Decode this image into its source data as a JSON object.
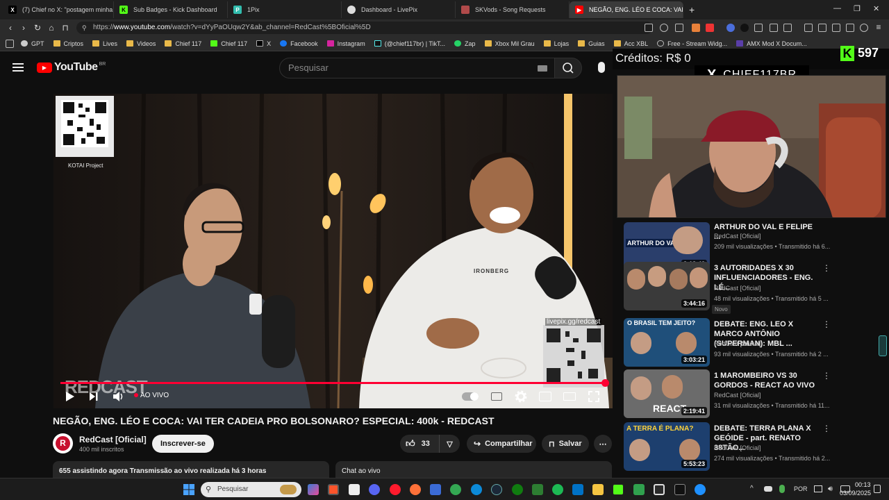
{
  "browser": {
    "tabs": [
      {
        "title": "(7) Chief no X: \"postagem minha de",
        "icon": "x-logo-icon",
        "color": "#000000"
      },
      {
        "title": "Sub Badges - Kick Dashboard",
        "icon": "kick-icon",
        "color": "#53fc18"
      },
      {
        "title": "1Pix",
        "icon": "pix-icon",
        "color": "#32bcad"
      },
      {
        "title": "Dashboard - LivePix",
        "icon": "livepix-icon",
        "color": "#dddddd"
      },
      {
        "title": "SKVods - Song Requests",
        "icon": "skvods-icon",
        "color": "#b04a4a"
      },
      {
        "title": "NEGÃO, ENG. LÉO E COCA: VAI TE",
        "icon": "youtube-icon",
        "color": "#ff0000"
      }
    ],
    "url_prefix": "https://",
    "url_host": "www.youtube.com",
    "url_path": "/watch?v=dYyPaOUqw2Y&ab_channel=RedCast%5BOficial%5D",
    "bookmarks": [
      {
        "label": "GPT",
        "icon": "gpt-icon"
      },
      {
        "label": "Criptos",
        "icon": "folder-icon"
      },
      {
        "label": "Lives",
        "icon": "folder-icon"
      },
      {
        "label": "Videos",
        "icon": "folder-icon"
      },
      {
        "label": "Chief 117",
        "icon": "folder-icon"
      },
      {
        "label": "Chief 117",
        "icon": "kick-icon"
      },
      {
        "label": "X",
        "icon": "x-logo-icon"
      },
      {
        "label": "Facebook",
        "icon": "facebook-icon"
      },
      {
        "label": "Instagram",
        "icon": "instagram-icon"
      },
      {
        "label": "(@chief117br) | TikT...",
        "icon": "tiktok-icon"
      },
      {
        "label": "Zap",
        "icon": "whatsapp-icon"
      },
      {
        "label": "Xbox Mil Grau",
        "icon": "folder-icon"
      },
      {
        "label": "Lojas",
        "icon": "folder-icon"
      },
      {
        "label": "Guias",
        "icon": "folder-icon"
      },
      {
        "label": "Acc XBL",
        "icon": "folder-icon"
      },
      {
        "label": "Free - Stream Widg...",
        "icon": "globe-icon"
      },
      {
        "label": "AMX Mod X Docum...",
        "icon": "amx-icon"
      }
    ]
  },
  "youtube": {
    "logo_text": "YouTube",
    "logo_region": "BR",
    "search_placeholder": "Pesquisar",
    "player": {
      "qr_top_label": "KOTAI Project",
      "qr_bottom_label": "livepix.gg/redcast",
      "watermark": "REDCAST",
      "live_label": "AO VIVO",
      "shirt_text": "IRONBERG",
      "progress_fraction": 1.0
    },
    "video_title": "NEGÃO, ENG. LÉO E COCA: VAI TER CADEIA PRO BOLSONARO? ESPECIAL: 400k - REDCAST",
    "channel_name": "RedCast [Oficial]",
    "subscribers": "400 mil inscritos",
    "subscribe_label": "Inscrever-se",
    "likes": "33",
    "share_label": "Compartilhar",
    "save_label": "Salvar",
    "stats_text": "655 assistindo agora  Transmissão ao vivo realizada há 3 horas",
    "chat_label": "Chat ao vivo"
  },
  "overlay": {
    "credits": "Créditos: R$ 0",
    "kick_count": "597",
    "handle": "CHIEF117BR"
  },
  "recommendations": [
    {
      "title": "ARTHUR DO VAL E FELIPE ...",
      "channel": "RedCast [Oficial]",
      "meta": "209 mil visualizações • Transmitido há 6...",
      "duration": "3:18:42",
      "badge": "",
      "thumb_color": "#2a3e6b",
      "thumb_text": "ARTHUR DO VAL"
    },
    {
      "title": "3 AUTORIDADES X 30 INFLUENCIADORES - ENG. LÉ...",
      "channel": "RedCast [Oficial]",
      "meta": "48 mil visualizações • Transmitido há 5 ...",
      "duration": "3:44:16",
      "badge": "Novo",
      "thumb_color": "#3a3a3a",
      "thumb_text": ""
    },
    {
      "title": "DEBATE: ENG. LEO X MARCO ANTÔNIO (SUPERMAN): MBL ...",
      "channel": "RedCast [Oficial]",
      "meta": "93 mil visualizações • Transmitido há 2 ...",
      "duration": "3:03:21",
      "badge": "",
      "thumb_color": "#1f4f7a",
      "thumb_text": "O BRASIL TEM JEITO?"
    },
    {
      "title": "1 MAROMBEIRO VS 30 GORDOS - REACT AO VIVO",
      "channel": "RedCast [Oficial]",
      "meta": "31 mil visualizações • Transmitido há 11...",
      "duration": "2:19:41",
      "badge": "",
      "thumb_color": "#6b6b6b",
      "thumb_text": "REACT"
    },
    {
      "title": "DEBATE: TERRA PLANA X GEÓIDE - part. RENATO 38TÃO...",
      "channel": "RedCast [Oficial]",
      "meta": "274 mil visualizações • Transmitido há 2...",
      "duration": "5:53:23",
      "badge": "",
      "thumb_color": "#1d3f6e",
      "thumb_text": "A TERRA É PLANA?"
    }
  ],
  "taskbar": {
    "search_placeholder": "Pesquisar",
    "language": "POR",
    "time": "00:13",
    "date": "03/09/2025"
  }
}
